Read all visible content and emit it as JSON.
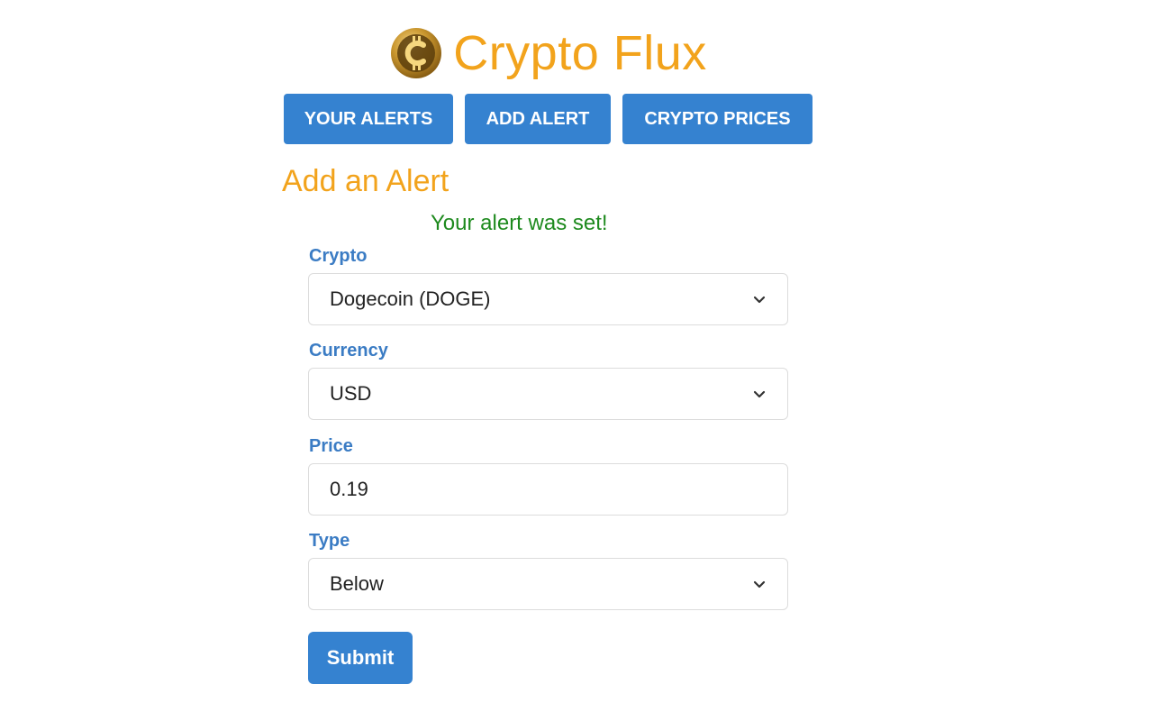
{
  "app": {
    "title": "Crypto Flux",
    "logo_icon": "bitcoin-coin-icon",
    "brand_color": "#f2a31c",
    "accent_color": "#3582d0"
  },
  "nav": {
    "items": [
      {
        "label": "YOUR ALERTS"
      },
      {
        "label": "ADD ALERT"
      },
      {
        "label": "CRYPTO PRICES"
      }
    ]
  },
  "form": {
    "heading": "Add an Alert",
    "success_message": "Your alert was set!",
    "success_color": "#1e8a1e",
    "fields": {
      "crypto": {
        "label": "Crypto",
        "value": "Dogecoin (DOGE)",
        "icon": "chevron-down-icon"
      },
      "currency": {
        "label": "Currency",
        "value": "USD",
        "icon": "chevron-down-icon"
      },
      "price": {
        "label": "Price",
        "value": "0.19"
      },
      "type": {
        "label": "Type",
        "value": "Below",
        "icon": "chevron-down-icon"
      }
    },
    "submit_label": "Submit"
  }
}
